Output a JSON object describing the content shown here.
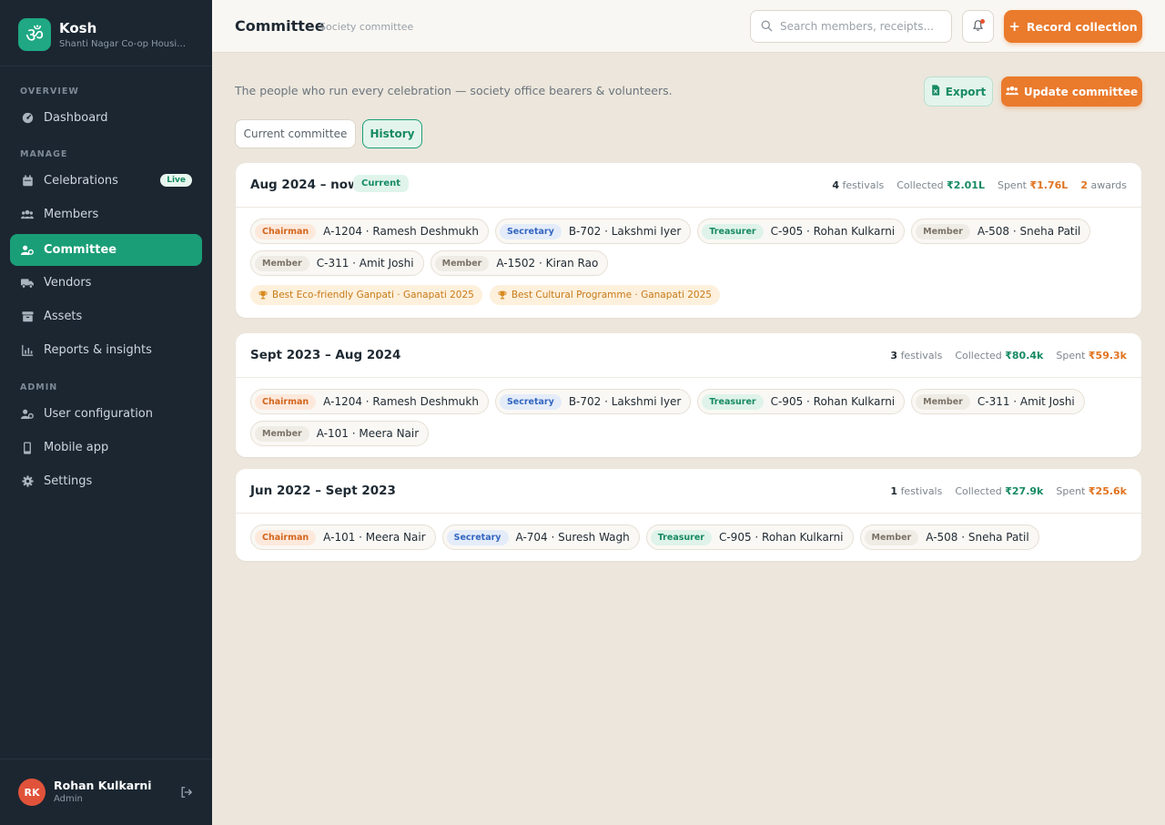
{
  "brand": {
    "name": "Kosh",
    "subtitle": "Shanti Nagar Co-op Housing Society",
    "logo_glyph": "ॐ",
    "color": "#1fa883"
  },
  "sidebar": {
    "sections": {
      "overview": "OVERVIEW",
      "manage": "MANAGE",
      "admin": "ADMIN"
    },
    "items": {
      "dashboard": {
        "label": "Dashboard",
        "icon": "gauge-icon"
      },
      "celebrations": {
        "label": "Celebrations",
        "icon": "calendar-icon",
        "badge": "Live"
      },
      "members": {
        "label": "Members",
        "icon": "users-icon"
      },
      "committee": {
        "label": "Committee",
        "icon": "user-cog-icon",
        "active": true
      },
      "vendors": {
        "label": "Vendors",
        "icon": "truck-icon"
      },
      "assets": {
        "label": "Assets",
        "icon": "archive-icon"
      },
      "reports": {
        "label": "Reports & insights",
        "icon": "chart-icon"
      },
      "user_config": {
        "label": "User configuration",
        "icon": "user-cog-icon"
      },
      "mobile": {
        "label": "Mobile app",
        "icon": "mobile-icon"
      },
      "settings": {
        "label": "Settings",
        "icon": "gear-icon"
      }
    },
    "user": {
      "initials": "RK",
      "name": "Rohan Kulkarni",
      "role": "Admin"
    }
  },
  "header": {
    "title": "Committee",
    "subtitle": "Society committee",
    "search_placeholder": "Search members, receipts...",
    "record_label": "Record collection"
  },
  "main": {
    "intro": "The people who run every celebration — society office bearers & volunteers.",
    "export_label": "Export",
    "update_label": "Update committee",
    "tabs": {
      "current": "Current committee",
      "history": "History"
    }
  },
  "terms": [
    {
      "period": "Aug 2024 – now",
      "badge": "Current",
      "festivals": "4",
      "festivals_label": "festivals",
      "collected_label": "Collected",
      "collected": "₹2.01L",
      "spent_label": "Spent",
      "spent": "₹1.76L",
      "awards_count": "2",
      "awards_label": "awards",
      "members": [
        {
          "role": "Chairman",
          "who": "A-1204 · Ramesh Deshmukh"
        },
        {
          "role": "Secretary",
          "who": "B-702 · Lakshmi Iyer"
        },
        {
          "role": "Treasurer",
          "who": "C-905 · Rohan Kulkarni"
        },
        {
          "role": "Member",
          "who": "A-508 · Sneha Patil"
        },
        {
          "role": "Member",
          "who": "C-311 · Amit Joshi"
        },
        {
          "role": "Member",
          "who": "A-1502 · Kiran Rao"
        }
      ],
      "awards": [
        "Best Eco-friendly Ganpati · Ganapati 2025",
        "Best Cultural Programme · Ganapati 2025"
      ]
    },
    {
      "period": "Sept 2023 – Aug 2024",
      "festivals": "3",
      "festivals_label": "festivals",
      "collected_label": "Collected",
      "collected": "₹80.4k",
      "spent_label": "Spent",
      "spent": "₹59.3k",
      "members": [
        {
          "role": "Chairman",
          "who": "A-1204 · Ramesh Deshmukh"
        },
        {
          "role": "Secretary",
          "who": "B-702 · Lakshmi Iyer"
        },
        {
          "role": "Treasurer",
          "who": "C-905 · Rohan Kulkarni"
        },
        {
          "role": "Member",
          "who": "C-311 · Amit Joshi"
        },
        {
          "role": "Member",
          "who": "A-101 · Meera Nair"
        }
      ]
    },
    {
      "period": "Jun 2022 – Sept 2023",
      "festivals": "1",
      "festivals_label": "festivals",
      "collected_label": "Collected",
      "collected": "₹27.9k",
      "spent_label": "Spent",
      "spent": "₹25.6k",
      "members": [
        {
          "role": "Chairman",
          "who": "A-101 · Meera Nair"
        },
        {
          "role": "Secretary",
          "who": "A-704 · Suresh Wagh"
        },
        {
          "role": "Treasurer",
          "who": "C-905 · Rohan Kulkarni"
        },
        {
          "role": "Member",
          "who": "A-508 · Sneha Patil"
        }
      ]
    }
  ],
  "colors": {
    "accent_green": "#1a9e77",
    "accent_orange": "#ea7a2c",
    "sidebar_bg": "#1b2631",
    "page_bg": "#ece6dc"
  }
}
